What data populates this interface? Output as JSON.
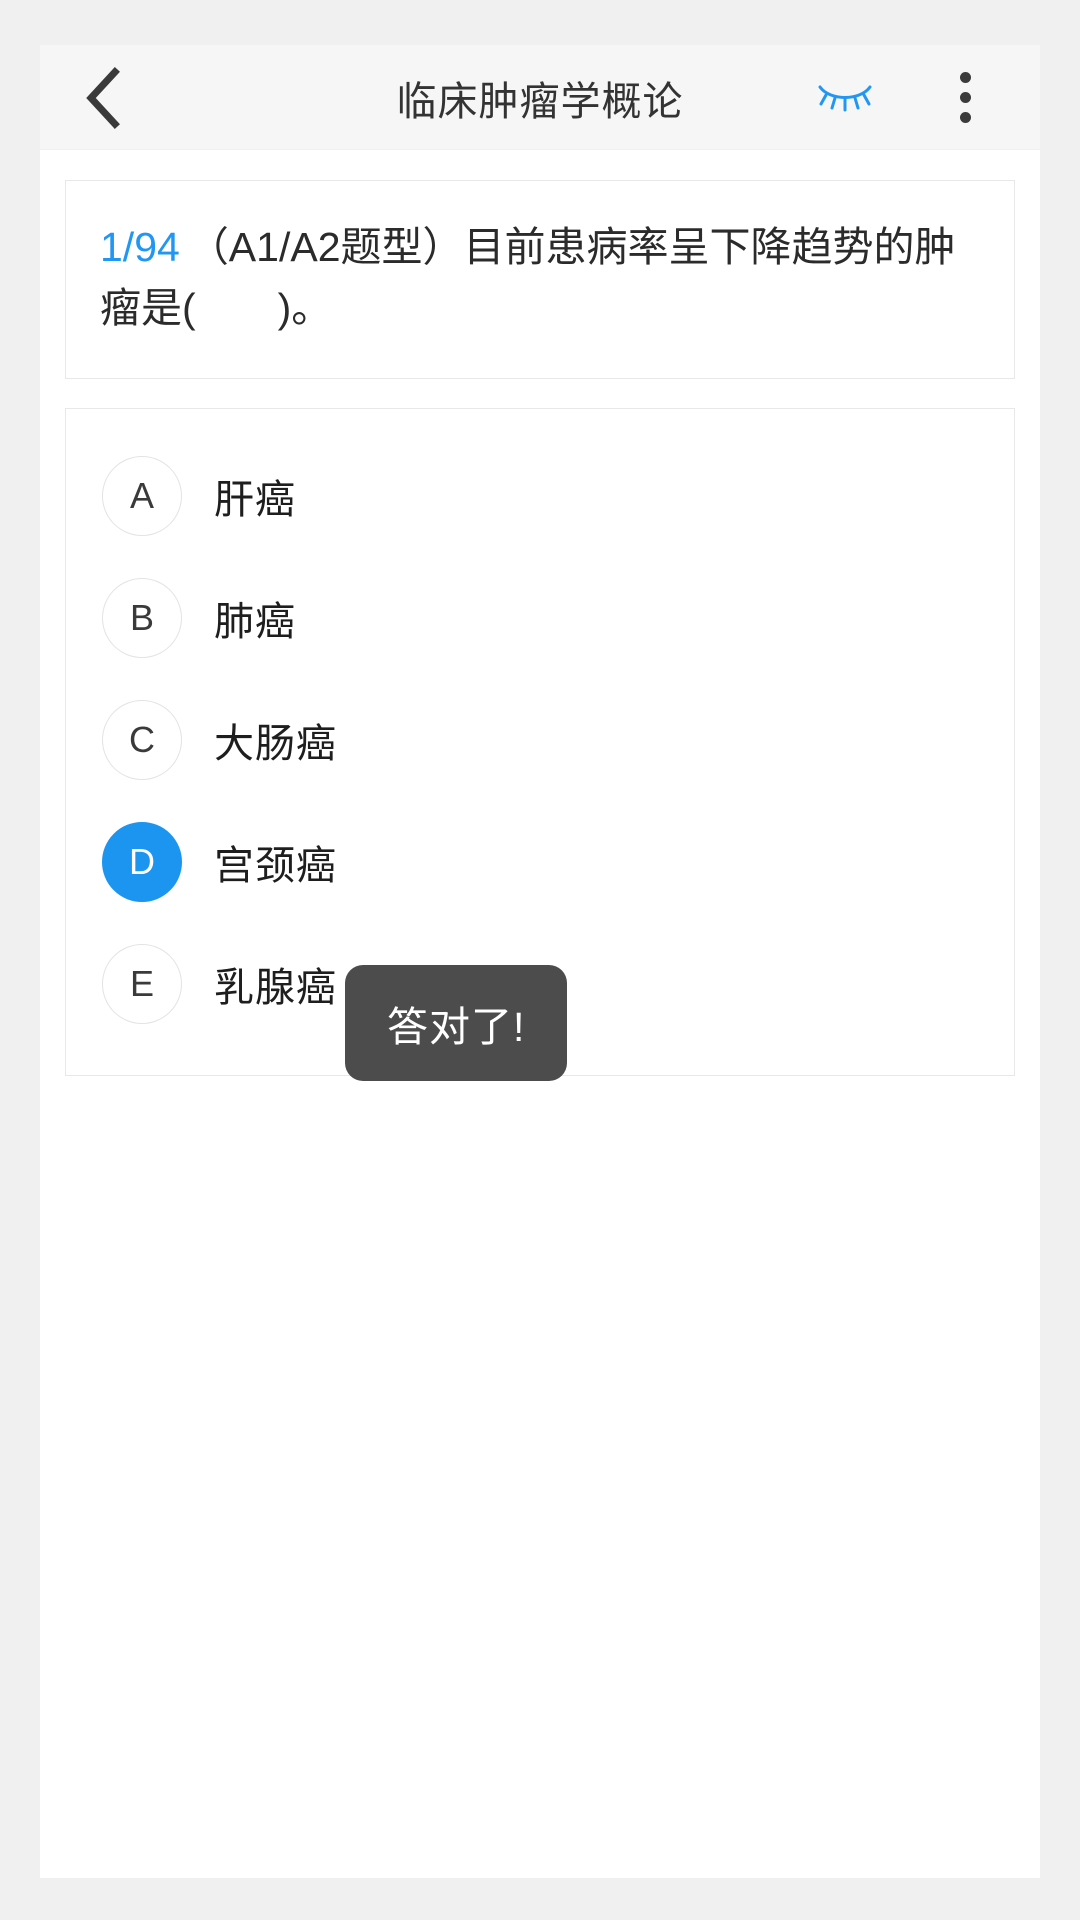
{
  "header": {
    "back_icon": "chevron-left-icon",
    "title": "临床肿瘤学概论",
    "eye_icon": "eye-off-icon",
    "eye_icon_color": "#1b95f0",
    "menu_icon": "more-vertical-icon"
  },
  "question": {
    "index": "1/94",
    "text": "（A1/A2题型）目前患病率呈下降趋势的肿瘤是(　　)。"
  },
  "options": [
    {
      "key": "A",
      "label": "肝癌",
      "selected": false
    },
    {
      "key": "B",
      "label": "肺癌",
      "selected": false
    },
    {
      "key": "C",
      "label": "大肠癌",
      "selected": false
    },
    {
      "key": "D",
      "label": "宫颈癌",
      "selected": true
    },
    {
      "key": "E",
      "label": "乳腺癌",
      "selected": false
    }
  ],
  "toast": {
    "message": "答对了!"
  },
  "colors": {
    "accent": "#1b95f0",
    "index_blue": "#2196f3",
    "toast_bg": "#4c4c4c",
    "page_bg": "#f0f0f0",
    "header_bg": "#f6f6f6",
    "card_border": "#e8e8e8"
  }
}
